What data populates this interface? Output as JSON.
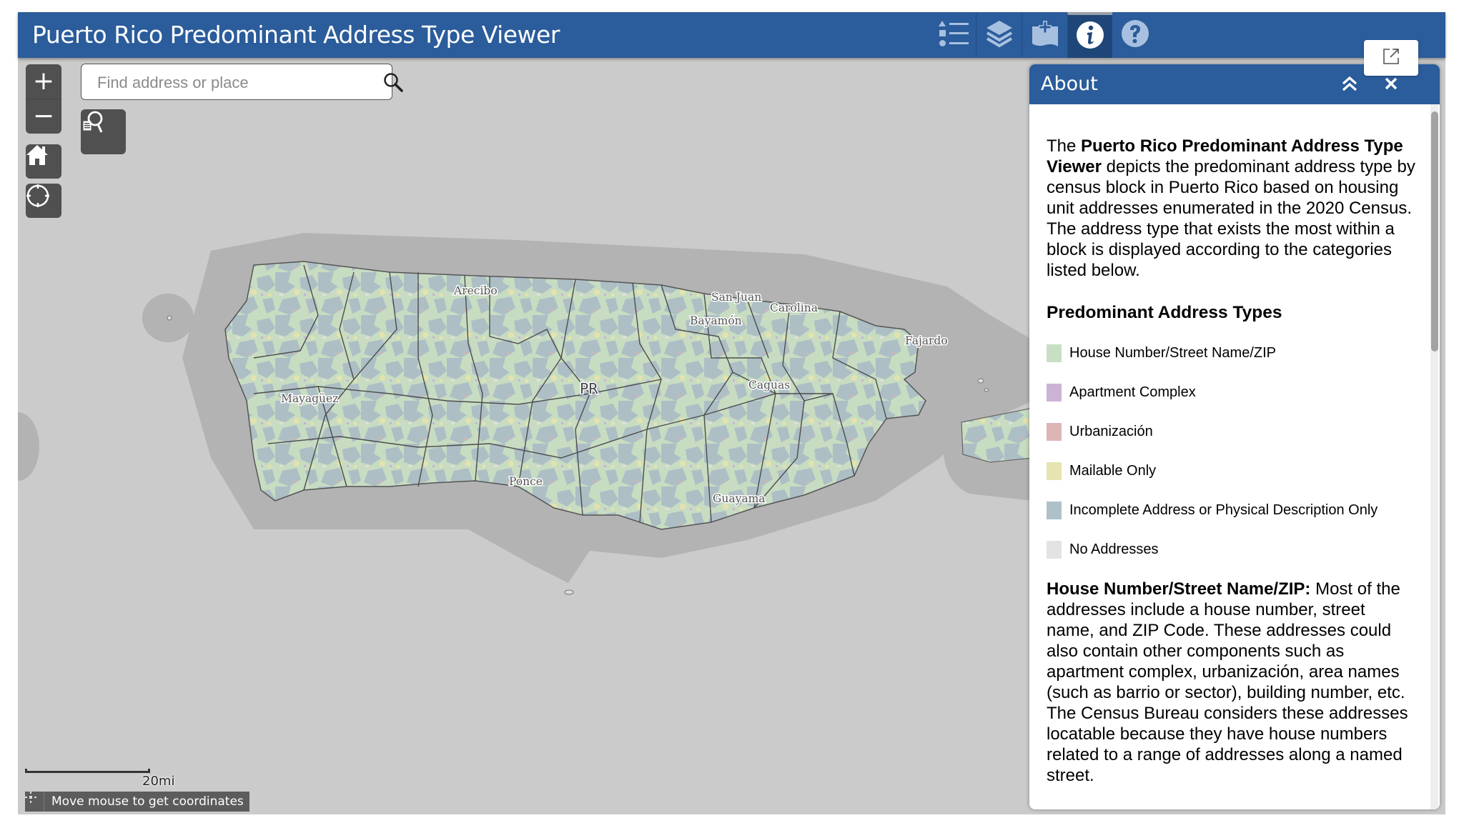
{
  "header": {
    "title": "Puerto Rico Predominant Address Type Viewer",
    "buttons": [
      {
        "icon": "legend-icon",
        "label": "Legend"
      },
      {
        "icon": "layers-icon",
        "label": "Layer List"
      },
      {
        "icon": "add-data-icon",
        "label": "Add Data"
      },
      {
        "icon": "info-icon",
        "label": "About",
        "active": true
      },
      {
        "icon": "help-icon",
        "label": "Help"
      }
    ],
    "popup_icon": "external-link-icon"
  },
  "map": {
    "controls": {
      "zoom_in": "+",
      "zoom_out": "−",
      "home_icon": "home-icon",
      "locate_icon": "locate-icon",
      "find_icon": "find-document-icon"
    },
    "search": {
      "placeholder": "Find address or place",
      "value": "",
      "icon": "search-icon"
    },
    "labels": [
      {
        "name": "Arecibo"
      },
      {
        "name": "San Juan"
      },
      {
        "name": "Carolina"
      },
      {
        "name": "Bayamón"
      },
      {
        "name": "Fajardo"
      },
      {
        "name": "Mayagüez"
      },
      {
        "name": "PR"
      },
      {
        "name": "Caguas"
      },
      {
        "name": "Ponce"
      },
      {
        "name": "Guayama"
      }
    ],
    "scalebar": {
      "label": "20mi"
    },
    "coordinates": {
      "text": "Move mouse to get coordinates"
    }
  },
  "panel": {
    "title": "About",
    "intro": {
      "prefix": "The ",
      "bold": "Puerto Rico Predominant Address Type Viewer",
      "suffix": " depicts the predominant address type by census block in Puerto Rico based on housing unit addresses enumerated in the 2020 Census. The address type that exists the most within a block is displayed according to the categories listed below."
    },
    "legend_title": "Predominant Address Types",
    "legend": [
      {
        "label": "House Number/Street Name/ZIP",
        "color": "#c8dfc4"
      },
      {
        "label": "Apartment Complex",
        "color": "#cbb3d8"
      },
      {
        "label": "Urbanización",
        "color": "#dcb6b6"
      },
      {
        "label": "Mailable Only",
        "color": "#e6e4b0"
      },
      {
        "label": "Incomplete Address or Physical Description Only",
        "color": "#aec1c8"
      },
      {
        "label": "No Addresses",
        "color": "#e3e3e3"
      }
    ],
    "description": {
      "bold": "House Number/Street Name/ZIP:",
      "text": " Most of the addresses include a house number, street name, and ZIP Code. These addresses could also contain other components such as apartment complex, urbanización, area names (such as barrio or sector), building number, etc. The Census Bureau considers these addresses locatable because they have house numbers related to a range of addresses along a named street."
    }
  },
  "colors": {
    "header_bg": "#2b5c9b",
    "header_active": "#1f4678",
    "map_bg": "#cbcbcb",
    "buffer": "#b3b3b3",
    "control_bg": "#505050"
  }
}
